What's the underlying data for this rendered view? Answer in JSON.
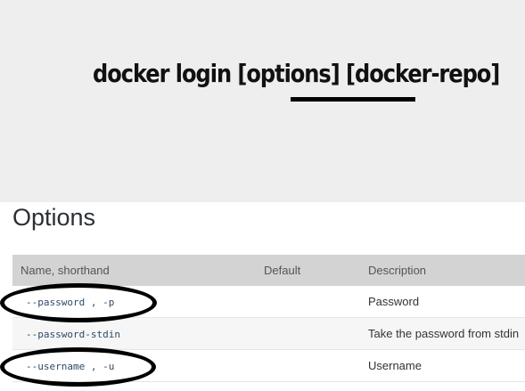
{
  "banner": {
    "command": "docker login [options] [docker-repo]"
  },
  "options": {
    "heading": "Options",
    "columns": {
      "name": "Name, shorthand",
      "default": "Default",
      "description": "Description"
    },
    "rows": [
      {
        "name": "--password , -p",
        "default": "",
        "description": "Password",
        "circled": true
      },
      {
        "name": "--password-stdin",
        "default": "",
        "description": "Take the password from stdin",
        "circled": false
      },
      {
        "name": "--username , -u",
        "default": "",
        "description": "Username",
        "circled": true
      }
    ]
  }
}
